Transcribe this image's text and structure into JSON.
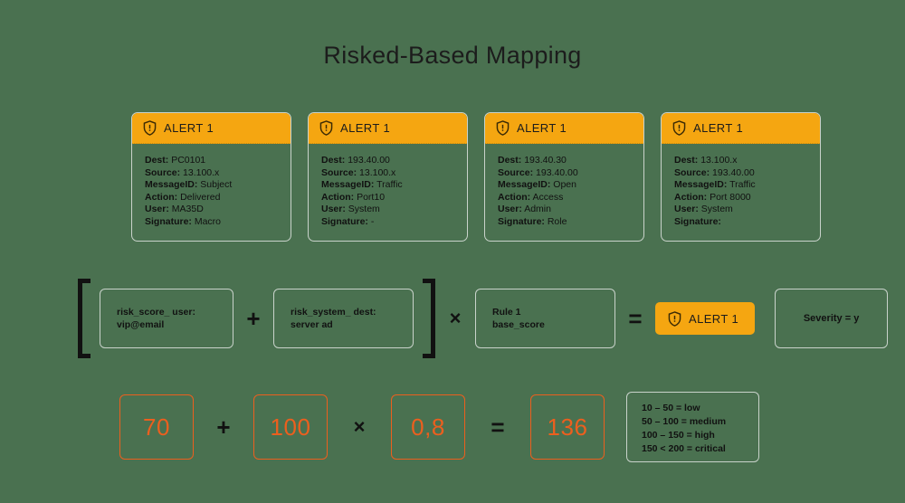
{
  "title": "Risked-Based Mapping",
  "colors": {
    "background": "#4a7150",
    "alert_orange": "#f5a611",
    "number_orange": "#ec5f1e",
    "border_gray": "#c9d3cb",
    "text_black": "#111111"
  },
  "alert_cards": [
    {
      "header_label": "ALERT 1",
      "icon": "shield-alert-icon",
      "fields": [
        {
          "key": "Dest:",
          "value": "PC0101"
        },
        {
          "key": "Source:",
          "value": "13.100.x"
        },
        {
          "key": "MessageID:",
          "value": "Subject"
        },
        {
          "key": "Action:",
          "value": "Delivered"
        },
        {
          "key": "User:",
          "value": "MA35D"
        },
        {
          "key": "Signature:",
          "value": "Macro"
        }
      ]
    },
    {
      "header_label": "ALERT 1",
      "icon": "shield-alert-icon",
      "fields": [
        {
          "key": "Dest:",
          "value": "193.40.00"
        },
        {
          "key": "Source:",
          "value": "13.100.x"
        },
        {
          "key": "MessageID:",
          "value": "Traffic"
        },
        {
          "key": "Action:",
          "value": "Port10"
        },
        {
          "key": "User:",
          "value": "System"
        },
        {
          "key": "Signature:",
          "value": "-"
        }
      ]
    },
    {
      "header_label": "ALERT 1",
      "icon": "shield-alert-icon",
      "fields": [
        {
          "key": "Dest:",
          "value": "193.40.30"
        },
        {
          "key": "Source:",
          "value": "193.40.00"
        },
        {
          "key": "MessageID:",
          "value": "Open"
        },
        {
          "key": "Action:",
          "value": "Access"
        },
        {
          "key": "User:",
          "value": "Admin"
        },
        {
          "key": "Signature:",
          "value": "Role"
        }
      ]
    },
    {
      "header_label": "ALERT 1",
      "icon": "shield-alert-icon",
      "fields": [
        {
          "key": "Dest:",
          "value": "13.100.x"
        },
        {
          "key": "Source:",
          "value": "193.40.00"
        },
        {
          "key": "MessageID:",
          "value": "Traffic"
        },
        {
          "key": "Action:",
          "value": "Port 8000"
        },
        {
          "key": "User:",
          "value": "System"
        },
        {
          "key": "Signature:",
          "value": ""
        }
      ]
    }
  ],
  "formula_row": {
    "term_user": "risk_score_ user:\nvip@email",
    "operator_plus": "+",
    "term_system": "risk_system_ dest:\nserver ad",
    "operator_times": "×",
    "term_rule": "Rule 1\nbase_score",
    "operator_equals": "=",
    "result_badge_label": "ALERT 1",
    "result_badge_icon": "shield-alert-icon",
    "severity_label": "Severity = y"
  },
  "numeric_row": {
    "value_user": "70",
    "operator_plus": "+",
    "value_system": "100",
    "operator_times": "×",
    "value_rule": "0,8",
    "operator_equals": "=",
    "value_result": "136",
    "legend": [
      "10 – 50 = low",
      "50 – 100 = medium",
      "100 – 150 = high",
      "150 < 200 = critical"
    ]
  }
}
